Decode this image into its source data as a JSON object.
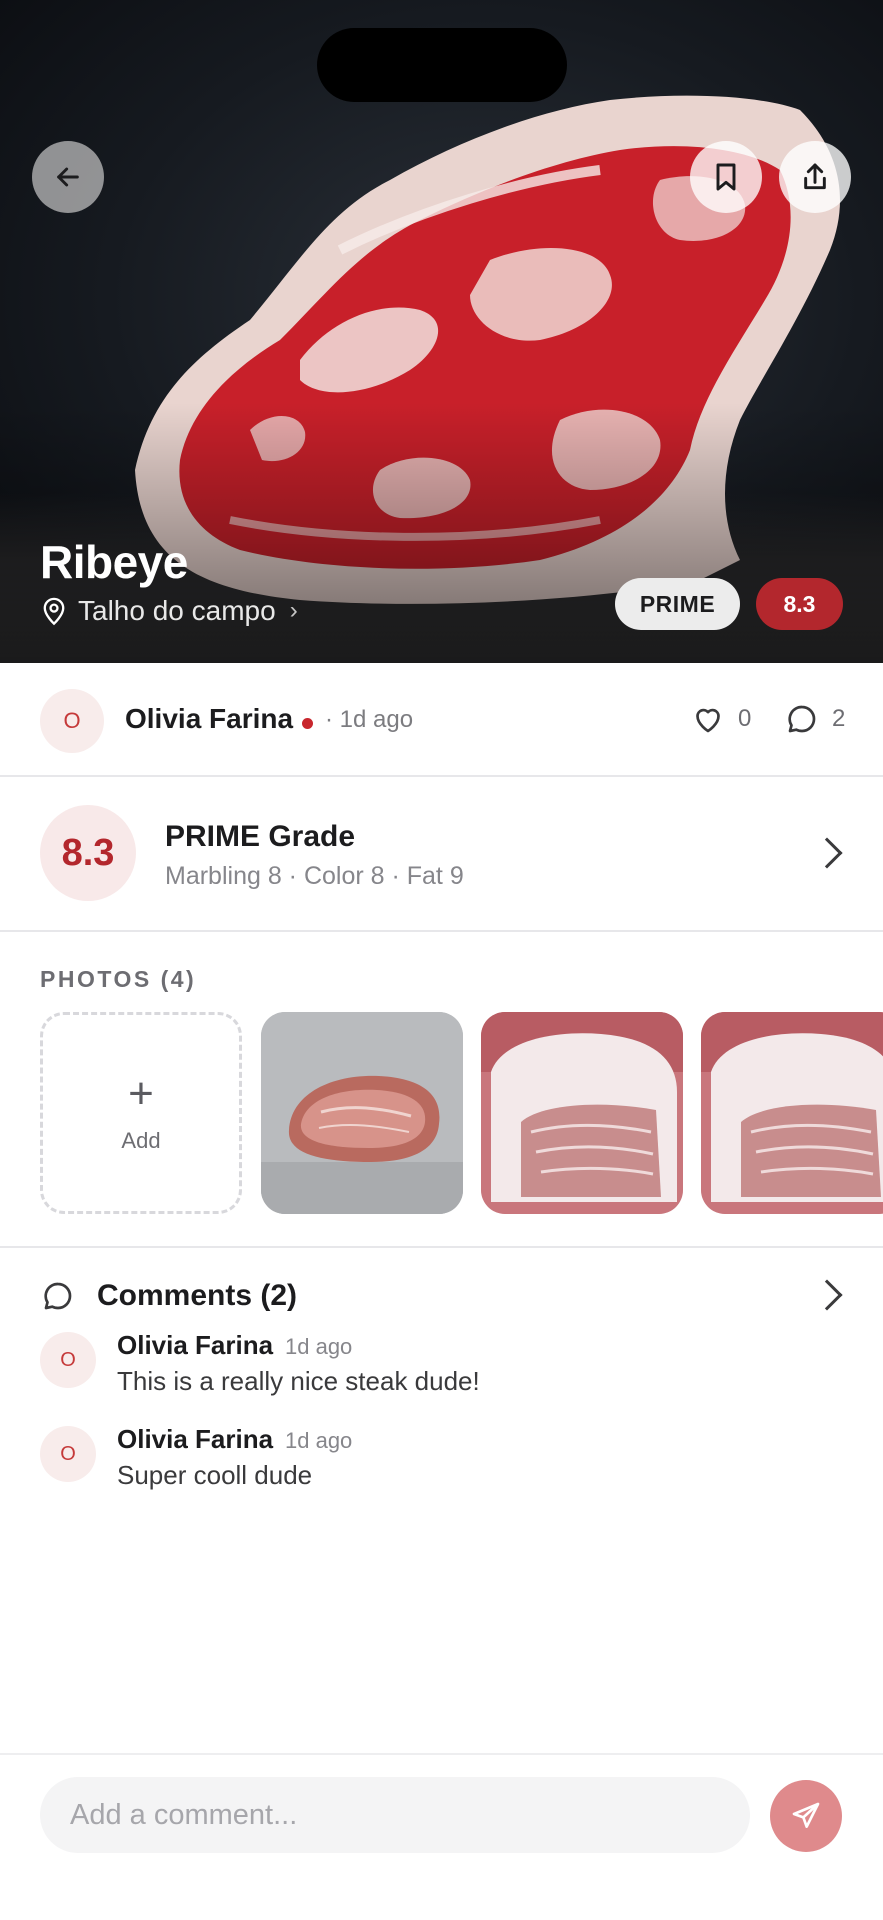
{
  "hero": {
    "title": "Ribeye",
    "location": "Talho do campo",
    "grade_badge": "PRIME",
    "score_badge": "8.3"
  },
  "author": {
    "avatar_initial": "O",
    "name": "Olivia Farina",
    "time": "· 1d ago",
    "likes": "0",
    "comments": "2"
  },
  "grade": {
    "score": "8.3",
    "title": "PRIME Grade",
    "subtitle": "Marbling 8 · Color 8 · Fat 9"
  },
  "photos": {
    "label": "PHOTOS (4)",
    "add_label": "Add"
  },
  "comments": {
    "title": "Comments (2)",
    "items": [
      {
        "initial": "O",
        "author": "Olivia Farina",
        "time": "1d ago",
        "text": "This is a really nice steak dude!"
      },
      {
        "initial": "O",
        "author": "Olivia Farina",
        "time": "1d ago",
        "text": "Super cooll dude"
      }
    ]
  },
  "composer": {
    "placeholder": "Add a comment..."
  },
  "colors": {
    "accent": "#b3272d",
    "accent_soft": "#f8e9e9",
    "send_button": "#df8a8c"
  },
  "icons": {
    "back": "arrow-left-icon",
    "bookmark": "bookmark-icon",
    "share": "share-icon",
    "location": "map-pin-icon",
    "like": "heart-icon",
    "comment": "chat-bubble-icon",
    "chevron": "chevron-right-icon",
    "add": "plus-icon",
    "send": "paper-plane-icon"
  }
}
